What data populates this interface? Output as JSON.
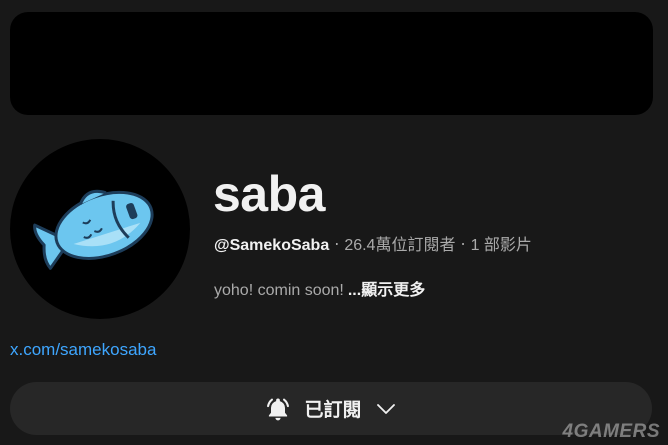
{
  "channel": {
    "name": "saba",
    "handle": "@SamekoSaba",
    "subscribers": "26.4萬位訂閱者",
    "videos": "1 部影片",
    "separator": "‧",
    "description": "yoho! comin soon!",
    "show_more": "...顯示更多",
    "link": "x.com/samekosaba"
  },
  "subscribe_button": {
    "label": "已訂閱",
    "bell_icon": "bell-icon",
    "chevron_icon": "chevron-down-icon"
  },
  "watermark": "4GAMERS",
  "colors": {
    "background": "#181818",
    "banner": "#000000",
    "link": "#3ea6ff",
    "button_bg": "#272727",
    "fish": "#5bc0eb"
  }
}
